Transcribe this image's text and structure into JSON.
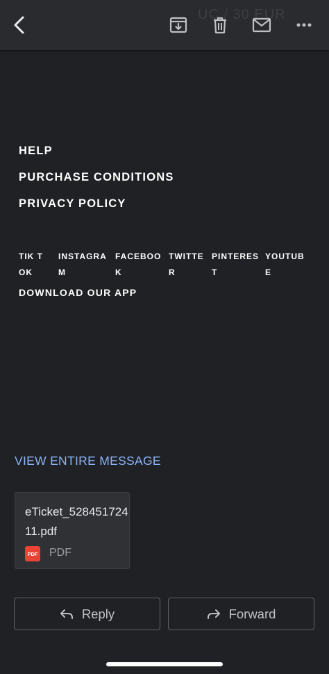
{
  "toolbar": {
    "icons": [
      "back-arrow-icon",
      "archive-icon",
      "trash-icon",
      "mail-icon",
      "more-icon"
    ],
    "background_text": "UC / 30 EUR"
  },
  "footer_links": [
    "HELP",
    "PURCHASE CONDITIONS",
    "PRIVACY POLICY"
  ],
  "socials": [
    "TIK TOK",
    "INSTAGRAM",
    "FACEBOOK",
    "TWITTER",
    "PINTEREST",
    "YOUTUBE"
  ],
  "download_app": "DOWNLOAD OUR APP",
  "view_entire_message": "VIEW ENTIRE MESSAGE",
  "attachment": {
    "filename": "eTicket_52845172411.pdf",
    "type_badge": "PDF",
    "type_label": "PDF"
  },
  "actions": {
    "reply": "Reply",
    "forward": "Forward"
  },
  "colors": {
    "background": "#202124",
    "toolbar": "#2a2b2e",
    "link": "#8ab4f8",
    "pdf": "#ea4335"
  }
}
